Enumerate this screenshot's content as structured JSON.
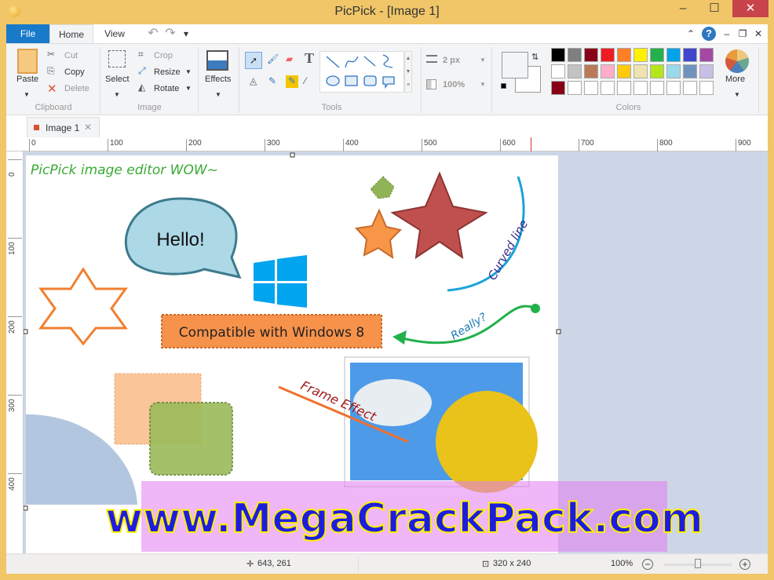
{
  "window": {
    "title": "PicPick - [Image 1]",
    "minimize": "–",
    "maximize": "☐",
    "close": "✕"
  },
  "menu": {
    "file": "File",
    "home": "Home",
    "view": "View",
    "undo": "↶",
    "redo": "↷",
    "qa_dropdown": "▾",
    "ribbon_collapse": "⌃",
    "help": "?",
    "doc_min": "–",
    "doc_restore": "❐",
    "doc_close": "✕"
  },
  "clipboard": {
    "paste": "Paste",
    "cut": "Cut",
    "copy": "Copy",
    "delete": "Delete",
    "group": "Clipboard"
  },
  "image": {
    "select": "Select",
    "crop": "Crop",
    "resize": "Resize",
    "rotate": "Rotate",
    "group": "Image"
  },
  "effects": {
    "label": "Effects"
  },
  "tools": {
    "group": "Tools"
  },
  "stroke": {
    "width": "2 px",
    "opacity": "100%"
  },
  "colors": {
    "group": "Colors",
    "more": "More",
    "palette": [
      "#000000",
      "#7f7f7f",
      "#880015",
      "#ed1c24",
      "#ff7f27",
      "#fff200",
      "#22b14c",
      "#00a2e8",
      "#3f48cc",
      "#a349a4",
      "#ffffff",
      "#c3c3c3",
      "#b97a57",
      "#ffaec9",
      "#ffc90e",
      "#efe4b0",
      "#b5e61d",
      "#99d9ea",
      "#7092be",
      "#c8bfe7",
      "#880015",
      "#ffffff",
      "#ffffff",
      "#ffffff",
      "#ffffff",
      "#ffffff",
      "#ffffff",
      "#ffffff",
      "#ffffff",
      "#ffffff"
    ]
  },
  "doc_tab": {
    "label": "Image 1",
    "close": "✕"
  },
  "ruler_h": [
    "0",
    "100",
    "200",
    "300",
    "400",
    "500",
    "600",
    "700",
    "800",
    "900"
  ],
  "ruler_v": [
    "0",
    "100",
    "200",
    "300",
    "400"
  ],
  "canvas": {
    "heading": "PicPick image editor WOW~",
    "bubble": "Hello!",
    "banner": "Compatible with Windows 8",
    "curved": "Curved line",
    "really": "Really?",
    "frame": "Frame Effect",
    "watermark": "www.MegaCrackPack.com"
  },
  "status": {
    "cursor": "643, 261",
    "size": "320 x 240",
    "zoom": "100%",
    "zoom_level": 100
  }
}
